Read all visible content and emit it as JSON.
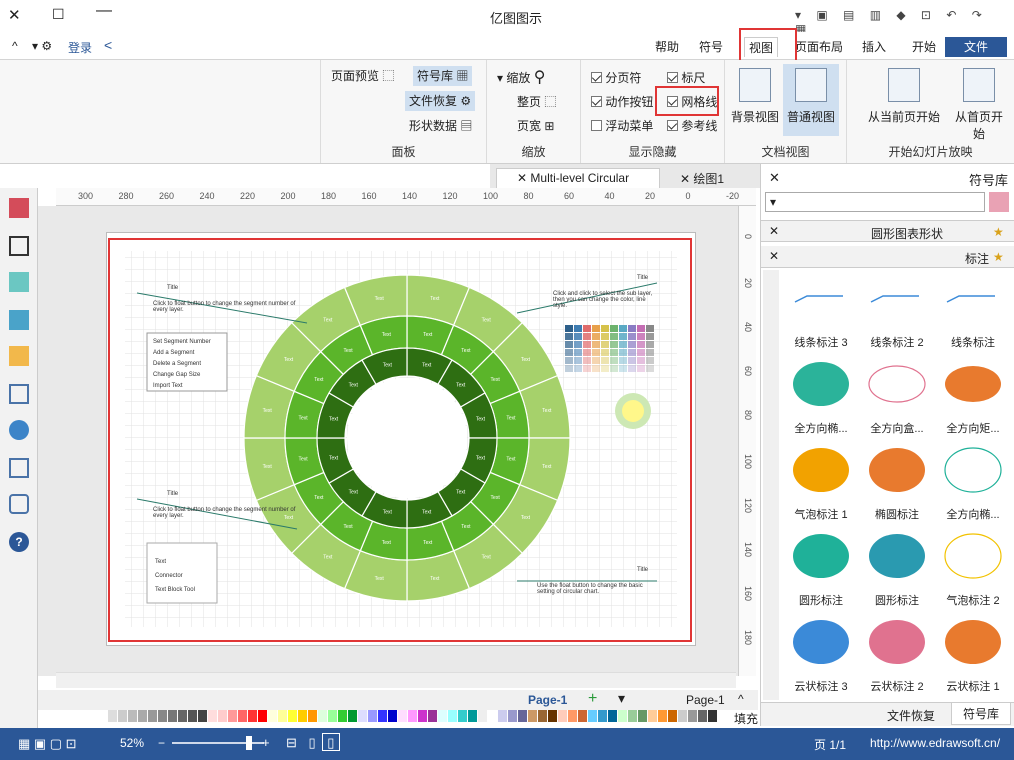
{
  "app_title": "亿图图示",
  "tabs": [
    "文件",
    "开始",
    "插入",
    "页面布局",
    "视图",
    "符号",
    "帮助"
  ],
  "active_tab": "视图",
  "user": {
    "login": "登录"
  },
  "ribbon": {
    "slideshow": {
      "label": "开始幻灯片放映",
      "from_first": "从首页开始",
      "from_current": "从当前页开始"
    },
    "document_view": {
      "label": "文档视图",
      "normal": "普通视图",
      "background": "背景视图"
    },
    "show_hide": {
      "label": "显示隐藏",
      "ruler": "标尺",
      "pagebreak": "分页符",
      "grid": "网格线",
      "action_button": "动作按钮",
      "guides": "参考线",
      "float_menu": "浮动菜单",
      "ruler_checked": true,
      "pagebreak_checked": true,
      "grid_checked": true,
      "action_checked": true,
      "guides_checked": true,
      "float_checked": false
    },
    "zoom": {
      "label": "缩放",
      "zoom": "缩放",
      "whole_page": "整页",
      "page_width": "页宽"
    },
    "panels": {
      "label": "面板",
      "symbols": "符号库",
      "page_preview": "页面预览",
      "file_recovery": "文件恢复",
      "shape_data": "形状数据"
    }
  },
  "doc_tabs": [
    "绘图1",
    "Multi-level Circular"
  ],
  "right_panel": {
    "title": "符号库",
    "search_placeholder": "",
    "groups": [
      "圆形图表形状",
      "标注"
    ],
    "shapes": [
      [
        "线条标注",
        "线条标注 2",
        "线条标注 3"
      ],
      [
        "全方向矩...",
        "全方向盒...",
        "全方向椭..."
      ],
      [
        "全方向椭...",
        "椭圆标注",
        "气泡标注 1"
      ],
      [
        "气泡标注 2",
        "圆形标注",
        "圆形标注"
      ],
      [
        "云状标注 1",
        "云状标注 2",
        "云状标注 3"
      ]
    ],
    "bottom_tabs": [
      "符号库",
      "文件恢复"
    ]
  },
  "canvas": {
    "ruler_ticks": [
      "-20",
      "0",
      "20",
      "40",
      "60",
      "80",
      "100",
      "120",
      "140",
      "160",
      "180",
      "200",
      "220",
      "240",
      "260",
      "280",
      "300"
    ],
    "vruler_ticks": [
      "0",
      "20",
      "40",
      "60",
      "80",
      "100",
      "120",
      "140",
      "160",
      "180"
    ],
    "segment_label": "Text",
    "title_label": "Title",
    "menu_items": [
      "Set Segment Number",
      "Add a Segment",
      "Delete a Segment",
      "Change Gap Size",
      "Import Text"
    ],
    "callout_text_1": "Click to float button to change the segment number of every layer.",
    "callout_text_2": "Click to float button to change the segment number of every layer.",
    "callout_text_3": "Click and click to select the sub layer, then you can change the color, line style.",
    "callout_text_4": "Use the float button to change the basic setting of circular chart.",
    "mini_menu": [
      "Text",
      "Connector",
      "Text Block Tool"
    ]
  },
  "page_tabs": {
    "page": "Page-1",
    "page2": "Page-1"
  },
  "fill_label": "填充",
  "status": {
    "url": "http://www.edrawsoft.cn/",
    "page": "页 1/1",
    "zoom": "52%"
  },
  "colors": {
    "ring_outer": "#a6d16b",
    "ring_mid": "#5bb52a",
    "ring_inner": "#2e6e12",
    "accent": "#2b5797",
    "highlight": "#e03535"
  }
}
